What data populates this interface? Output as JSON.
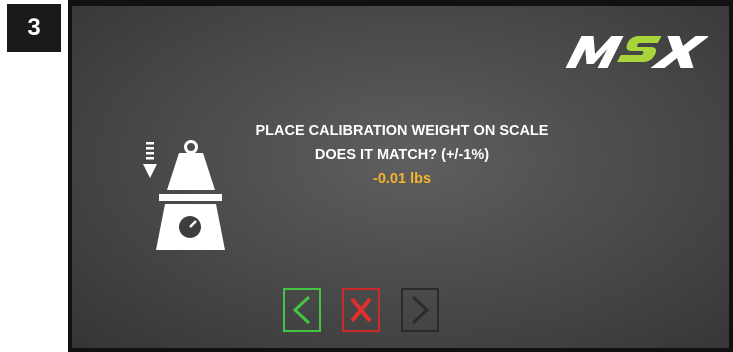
{
  "step": {
    "number": "3"
  },
  "logo": {
    "text": "MSX"
  },
  "message": {
    "instruction": "PLACE CALIBRATION WEIGHT ON SCALE",
    "question": "DOES IT MATCH? (+/-1%)",
    "reading": "-0.01 lbs"
  },
  "icons": {
    "scale": "scale-with-weight-icon",
    "back": "chevron-left-icon",
    "cancel": "x-icon",
    "next": "chevron-right-icon"
  },
  "colors": {
    "reading": "#f3b52f",
    "back_button": "#41c542",
    "cancel_button": "#c92b2b",
    "next_button": "#2b2b2b",
    "logo_accent": "#a8d63a"
  }
}
